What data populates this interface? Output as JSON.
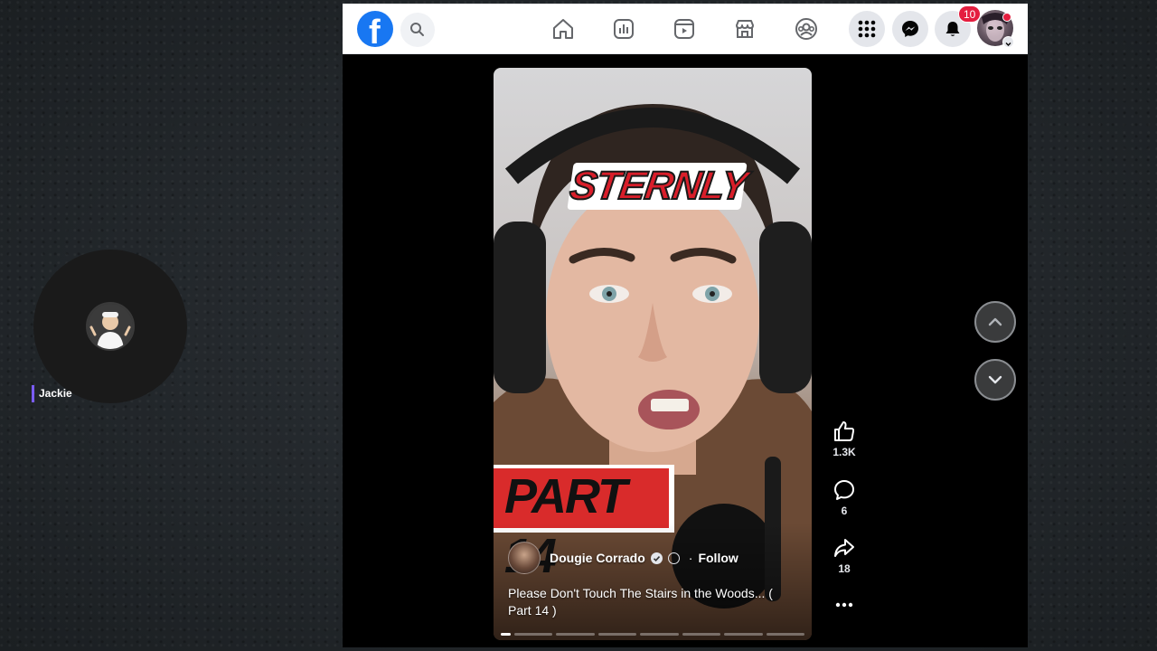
{
  "call": {
    "participant_name": "Jackie",
    "name_bar_color": "#7b5cff"
  },
  "topbar": {
    "logo_icon": "facebook-logo-icon",
    "notifications_count": "10",
    "icons": [
      "search-icon",
      "home-icon",
      "feeds-icon",
      "video-icon",
      "marketplace-icon",
      "groups-icon",
      "menu-grid-icon",
      "messenger-icon",
      "bell-icon"
    ]
  },
  "reel": {
    "sticker_top": "STERNLY",
    "sticker_bottom": "PART 14",
    "author_name": "Dougie Corrado",
    "dot_separator": "·",
    "follow_label": "Follow",
    "caption": "Please Don't Touch The Stairs in the Woods... ( Part 14 )",
    "progress_segments": 8,
    "progress_active": 1
  },
  "actions": {
    "likes": "1.3K",
    "comments": "6",
    "shares": "18"
  },
  "colors": {
    "brand_blue": "#1877f2",
    "badge_red": "#e41e3f",
    "sticker_red": "#d92b2b"
  }
}
